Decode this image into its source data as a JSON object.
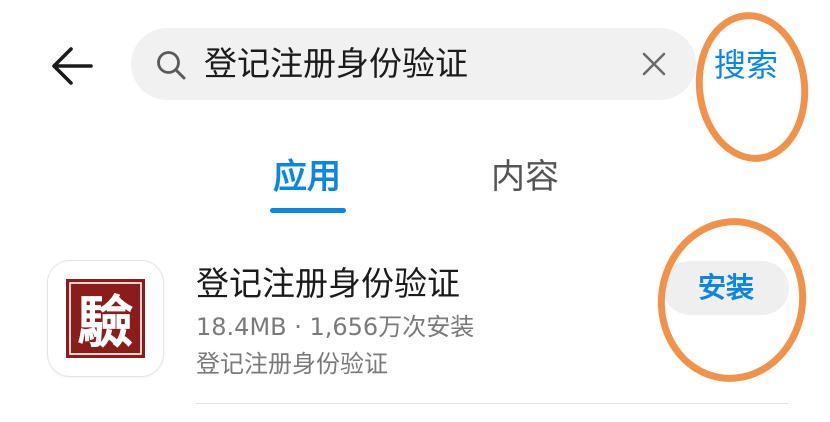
{
  "colors": {
    "accent": "#0a86e6",
    "annotation": "#f0924a",
    "icon_seal": "#8b1c1c"
  },
  "header": {
    "back_icon": "arrow-left-icon",
    "search": {
      "icon": "search-icon",
      "value": "登记注册身份验证",
      "clear_icon": "close-icon"
    },
    "search_button_label": "搜索"
  },
  "tabs": [
    {
      "label": "应用",
      "selected": true
    },
    {
      "label": "内容",
      "selected": false
    }
  ],
  "results": [
    {
      "icon": "seal-logo-icon",
      "icon_text": "驗",
      "name": "登记注册身份验证",
      "meta": "18.4MB · 1,656万次安装",
      "description": "登记注册身份验证",
      "action_label": "安装"
    }
  ]
}
